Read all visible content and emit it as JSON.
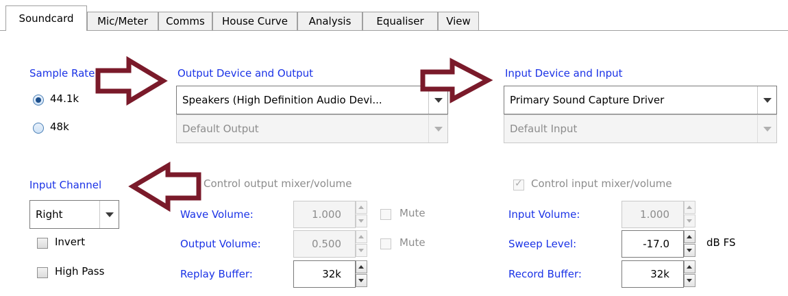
{
  "tabs": [
    "Soundcard",
    "Mic/Meter",
    "Comms",
    "House Curve",
    "Analysis",
    "Equaliser",
    "View"
  ],
  "sample_rate": {
    "heading": "Sample Rate",
    "options": [
      "44.1k",
      "48k"
    ],
    "selected": "44.1k"
  },
  "output": {
    "heading": "Output Device and Output",
    "device": "Speakers (High Definition Audio Devi...",
    "channel": "Default Output"
  },
  "input": {
    "heading": "Input Device and Input",
    "device": "Primary Sound Capture Driver",
    "channel": "Default Input"
  },
  "input_channel": {
    "heading": "Input Channel",
    "value": "Right",
    "invert_label": "Invert",
    "highpass_label": "High Pass"
  },
  "output_mixer": {
    "control_label": "Control output mixer/volume",
    "wave_volume_label": "Wave Volume:",
    "wave_volume": "1.000",
    "output_volume_label": "Output Volume:",
    "output_volume": "0.500",
    "mute_label": "Mute",
    "replay_buffer_label": "Replay Buffer:",
    "replay_buffer": "32k"
  },
  "input_mixer": {
    "control_label": "Control input mixer/volume",
    "input_volume_label": "Input Volume:",
    "input_volume": "1.000",
    "sweep_level_label": "Sweep Level:",
    "sweep_level": "-17.0",
    "sweep_unit": "dB FS",
    "record_buffer_label": "Record Buffer:",
    "record_buffer": "32k"
  },
  "colors": {
    "label_blue": "#1a32e6",
    "arrow": "#7a1a2a"
  },
  "icons": [
    "arrow-right-icon",
    "arrow-left-icon",
    "chevron-down-icon",
    "spin-up-icon",
    "spin-down-icon"
  ]
}
